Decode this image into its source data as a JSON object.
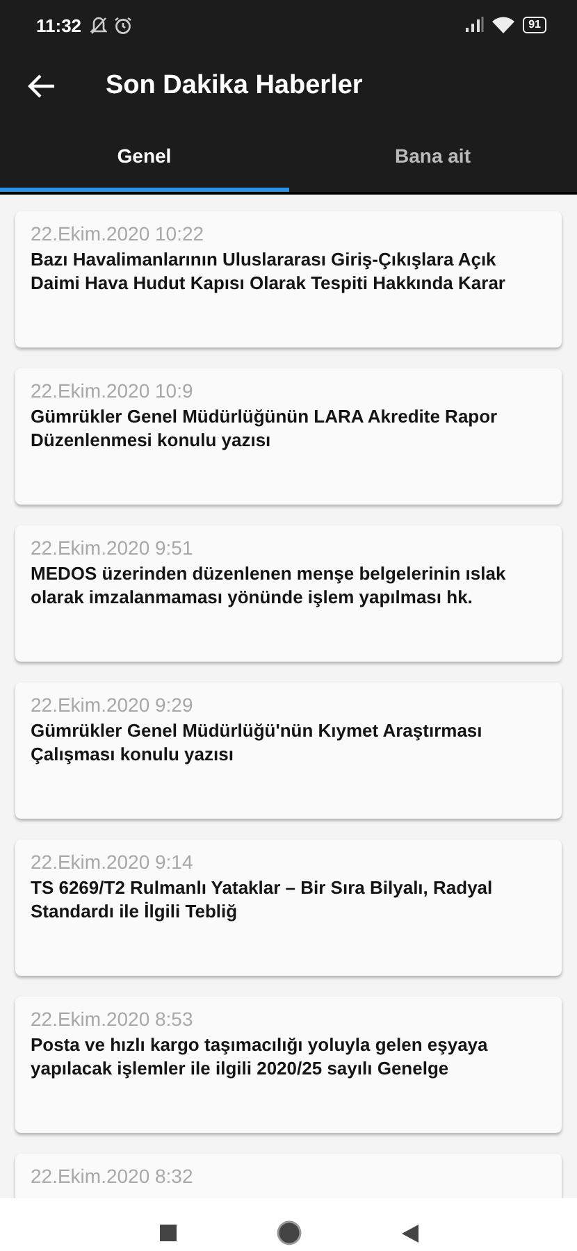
{
  "status_bar": {
    "time": "11:32",
    "battery": "91"
  },
  "toolbar": {
    "title": "Son Dakika Haberler"
  },
  "tabs": [
    {
      "label": "Genel",
      "selected": true
    },
    {
      "label": "Bana ait",
      "selected": false
    }
  ],
  "news": [
    {
      "date": "22.Ekim.2020 10:22",
      "title": "Bazı Havalimanlarının Uluslararası Giriş-Çıkışlara Açık Daimi Hava Hudut Kapısı Olarak Tespiti Hakkında Karar"
    },
    {
      "date": "22.Ekim.2020 10:9",
      "title": "Gümrükler Genel Müdürlüğünün LARA Akredite Rapor Düzenlenmesi konulu yazısı"
    },
    {
      "date": "22.Ekim.2020 9:51",
      "title": "MEDOS üzerinden düzenlenen menşe belgelerinin ıslak olarak imzalanmaması yönünde işlem yapılması hk."
    },
    {
      "date": "22.Ekim.2020 9:29",
      "title": "Gümrükler Genel Müdürlüğü'nün Kıymet Araştırması Çalışması konulu yazısı"
    },
    {
      "date": "22.Ekim.2020 9:14",
      "title": "TS 6269/T2 Rulmanlı Yataklar – Bir Sıra Bilyalı, Radyal Standardı ile İlgili Tebliğ"
    },
    {
      "date": "22.Ekim.2020 8:53",
      "title": "Posta ve hızlı kargo taşımacılığı yoluyla gelen eşyaya yapılacak işlemler ile ilgili  2020/25 sayılı Genelge"
    },
    {
      "date": "22.Ekim.2020 8:32"
    }
  ]
}
